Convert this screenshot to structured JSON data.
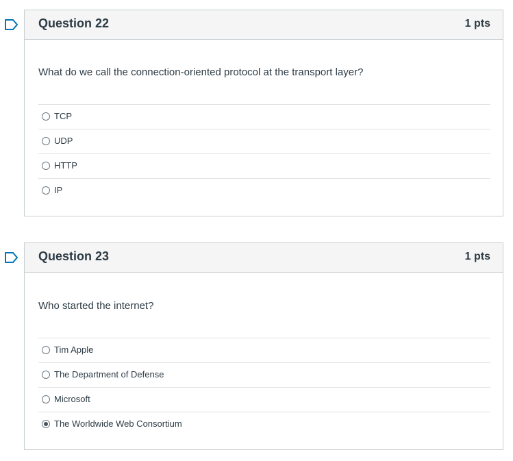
{
  "colors": {
    "flag": "#0374b5",
    "border": "#c7cdd1",
    "header_bg": "#f5f5f5",
    "text": "#2d3b45"
  },
  "questions": [
    {
      "title": "Question 22",
      "points": "1 pts",
      "prompt": "What do we call the connection-oriented protocol at the transport layer?",
      "answers": [
        {
          "label": "TCP",
          "selected": false
        },
        {
          "label": "UDP",
          "selected": false
        },
        {
          "label": "HTTP",
          "selected": false
        },
        {
          "label": "IP",
          "selected": false
        }
      ]
    },
    {
      "title": "Question 23",
      "points": "1 pts",
      "prompt": "Who started the internet?",
      "answers": [
        {
          "label": "Tim Apple",
          "selected": false
        },
        {
          "label": "The Department of Defense",
          "selected": false
        },
        {
          "label": "Microsoft",
          "selected": false
        },
        {
          "label": "The Worldwide Web Consortium",
          "selected": true
        }
      ]
    }
  ]
}
